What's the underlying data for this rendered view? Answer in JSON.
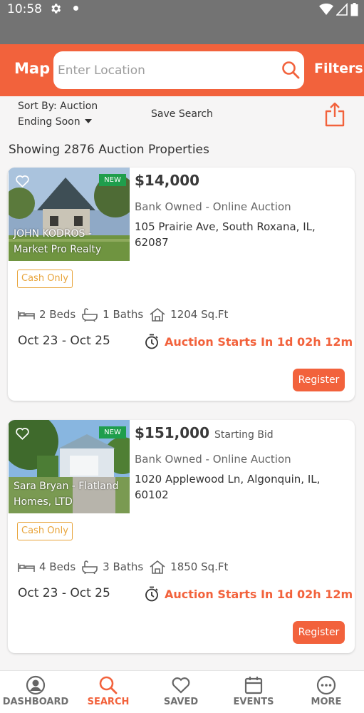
{
  "status_bar": {
    "time": "10:58"
  },
  "header": {
    "map_label": "Map",
    "search_placeholder": "Enter Location",
    "filters_label": "Filters"
  },
  "sort_bar": {
    "sort_line1": "Sort By: Auction",
    "sort_line2": "Ending Soon",
    "save_search_label": "Save Search"
  },
  "results": {
    "summary": "Showing 2876 Auction Properties"
  },
  "listings": [
    {
      "badge": "NEW",
      "agent": "JOHN KODROS - Market Pro Realty",
      "price": "$14,000",
      "price_note": "",
      "auction_type": "Bank Owned - Online Auction",
      "address": "105 Prairie Ave, South Roxana, IL, 62087",
      "payment": "Cash Only",
      "beds": "2 Beds",
      "baths": "1 Baths",
      "sqft": "1204 Sq.Ft",
      "dates": "Oct 23 - Oct 25",
      "countdown": "Auction Starts In 1d 02h 12m",
      "register_label": "Register"
    },
    {
      "badge": "NEW",
      "agent": "Sara Bryan - Flatland Homes, LTD",
      "price": "$151,000",
      "price_note": "Starting Bid",
      "auction_type": "Bank Owned - Online Auction",
      "address": "1020 Applewood Ln, Algonquin, IL, 60102",
      "payment": "Cash Only",
      "beds": "4 Beds",
      "baths": "3 Baths",
      "sqft": "1850 Sq.Ft",
      "dates": "Oct 23 - Oct 25",
      "countdown": "Auction Starts In 1d 02h 12m",
      "register_label": "Register"
    }
  ],
  "bottom_nav": [
    {
      "label": "DASHBOARD",
      "icon": "account-circle-icon",
      "active": false
    },
    {
      "label": "SEARCH",
      "icon": "search-icon",
      "active": true
    },
    {
      "label": "SAVED",
      "icon": "heart-icon",
      "active": false
    },
    {
      "label": "EVENTS",
      "icon": "calendar-icon",
      "active": false
    },
    {
      "label": "MORE",
      "icon": "more-icon",
      "active": false
    }
  ],
  "colors": {
    "accent": "#f2623c",
    "status_bar": "#737373",
    "cash_badge": "#e8a43a",
    "new_badge": "#1f9e4c"
  }
}
